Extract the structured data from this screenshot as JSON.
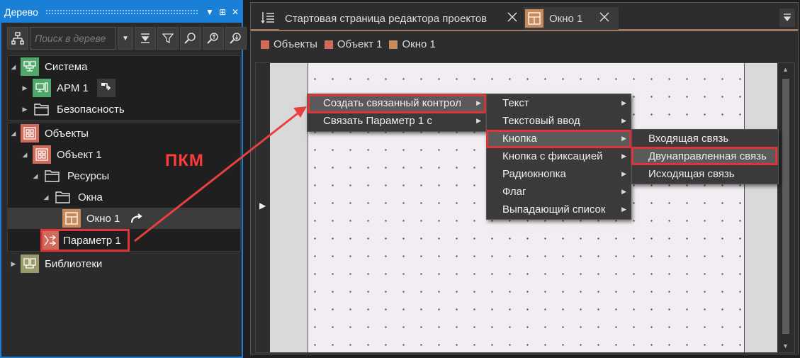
{
  "left_panel": {
    "title": "Дерево",
    "title_buttons": [
      "▼",
      "⊞",
      "✕"
    ],
    "search_placeholder": "Поиск в дереве",
    "tree": {
      "system": "Система",
      "arm": "АРМ 1",
      "security": "Безопасность",
      "objects": "Объекты",
      "object1": "Объект 1",
      "resources": "Ресурсы",
      "windows": "Окна",
      "window1": "Окно 1",
      "param1": "Параметр 1",
      "libraries": "Библиотеки"
    }
  },
  "annotation": {
    "pkm": "ПКМ"
  },
  "right_panel": {
    "tabs": [
      {
        "label": "Стартовая страница редактора проектов"
      },
      {
        "label": "Окно 1"
      }
    ],
    "breadcrumbs": [
      {
        "label": "Объекты",
        "color": "#d06a5a"
      },
      {
        "label": "Объект 1",
        "color": "#d06a5a"
      },
      {
        "label": "Окно 1",
        "color": "#c78a5a"
      }
    ],
    "context_menu": {
      "items": [
        "Создать связанный контрол",
        "Связать Параметр 1 с"
      ]
    },
    "submenu": {
      "items": [
        "Текст",
        "Текстовый ввод",
        "Кнопка",
        "Кнопка с фиксацией",
        "Радиокнопка",
        "Флаг",
        "Выпадающий список"
      ]
    },
    "submenu2": {
      "items": [
        "Входящая связь",
        "Двунаправленная связь",
        "Исходящая связь"
      ]
    }
  },
  "colors": {
    "accent": "#1a7fd6",
    "highlight_red": "#e0343b",
    "system_icon": "#4fa86a",
    "objects_icon": "#d06a5a",
    "window_icon": "#c78a5a",
    "library_icon": "#9a9a6a"
  }
}
